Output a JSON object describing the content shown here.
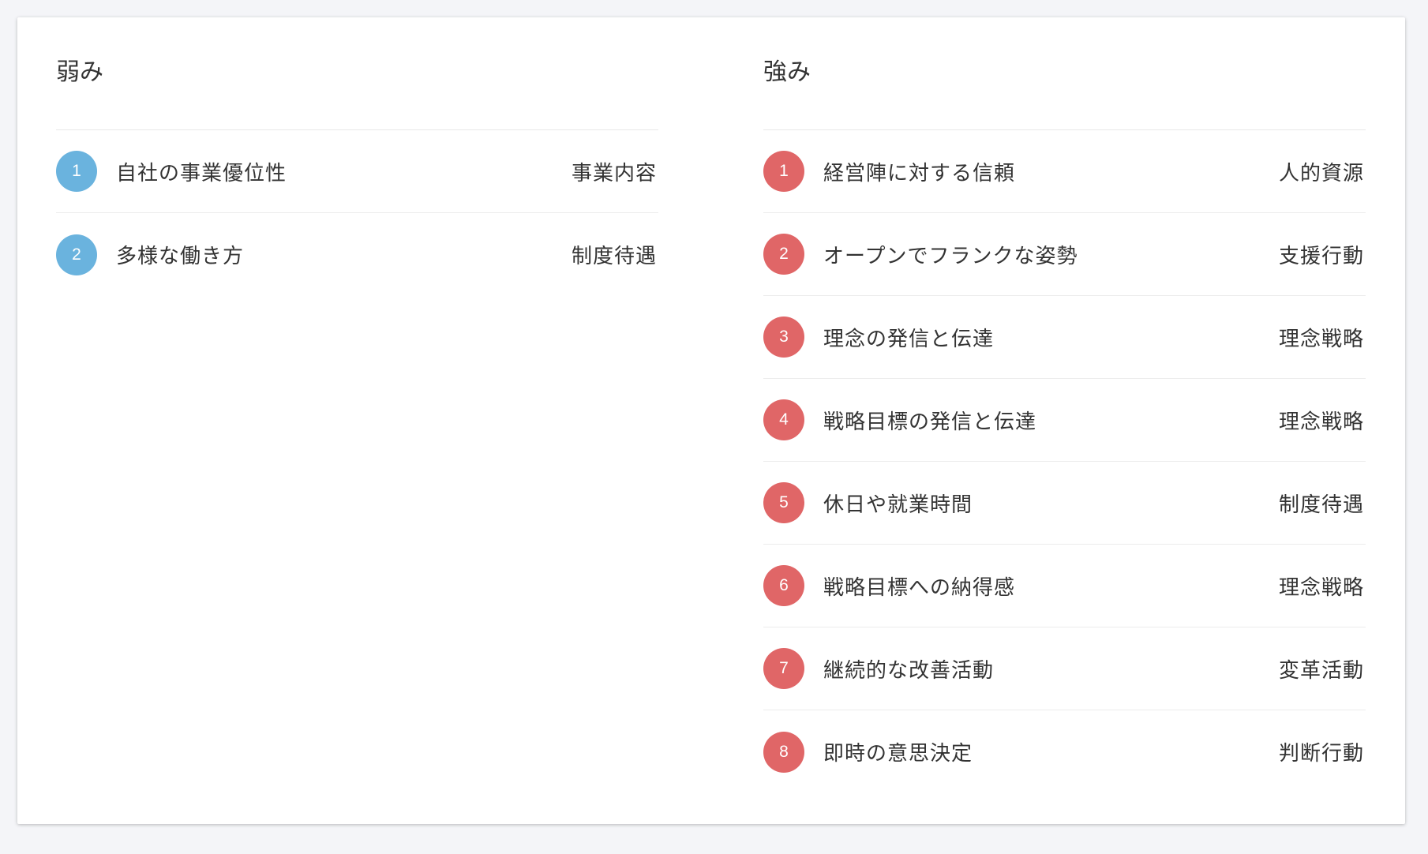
{
  "weaknesses": {
    "title": "弱み",
    "items": [
      {
        "num": "1",
        "label": "自社の事業優位性",
        "category": "事業内容"
      },
      {
        "num": "2",
        "label": "多様な働き方",
        "category": "制度待遇"
      }
    ]
  },
  "strengths": {
    "title": "強み",
    "items": [
      {
        "num": "1",
        "label": "経営陣に対する信頼",
        "category": "人的資源"
      },
      {
        "num": "2",
        "label": "オープンでフランクな姿勢",
        "category": "支援行動"
      },
      {
        "num": "3",
        "label": "理念の発信と伝達",
        "category": "理念戦略"
      },
      {
        "num": "4",
        "label": "戦略目標の発信と伝達",
        "category": "理念戦略"
      },
      {
        "num": "5",
        "label": "休日や就業時間",
        "category": "制度待遇"
      },
      {
        "num": "6",
        "label": "戦略目標への納得感",
        "category": "理念戦略"
      },
      {
        "num": "7",
        "label": "継続的な改善活動",
        "category": "変革活動"
      },
      {
        "num": "8",
        "label": "即時の意思決定",
        "category": "判断行動"
      }
    ]
  },
  "colors": {
    "weak_badge": "#6ab3de",
    "strong_badge": "#e06667"
  }
}
